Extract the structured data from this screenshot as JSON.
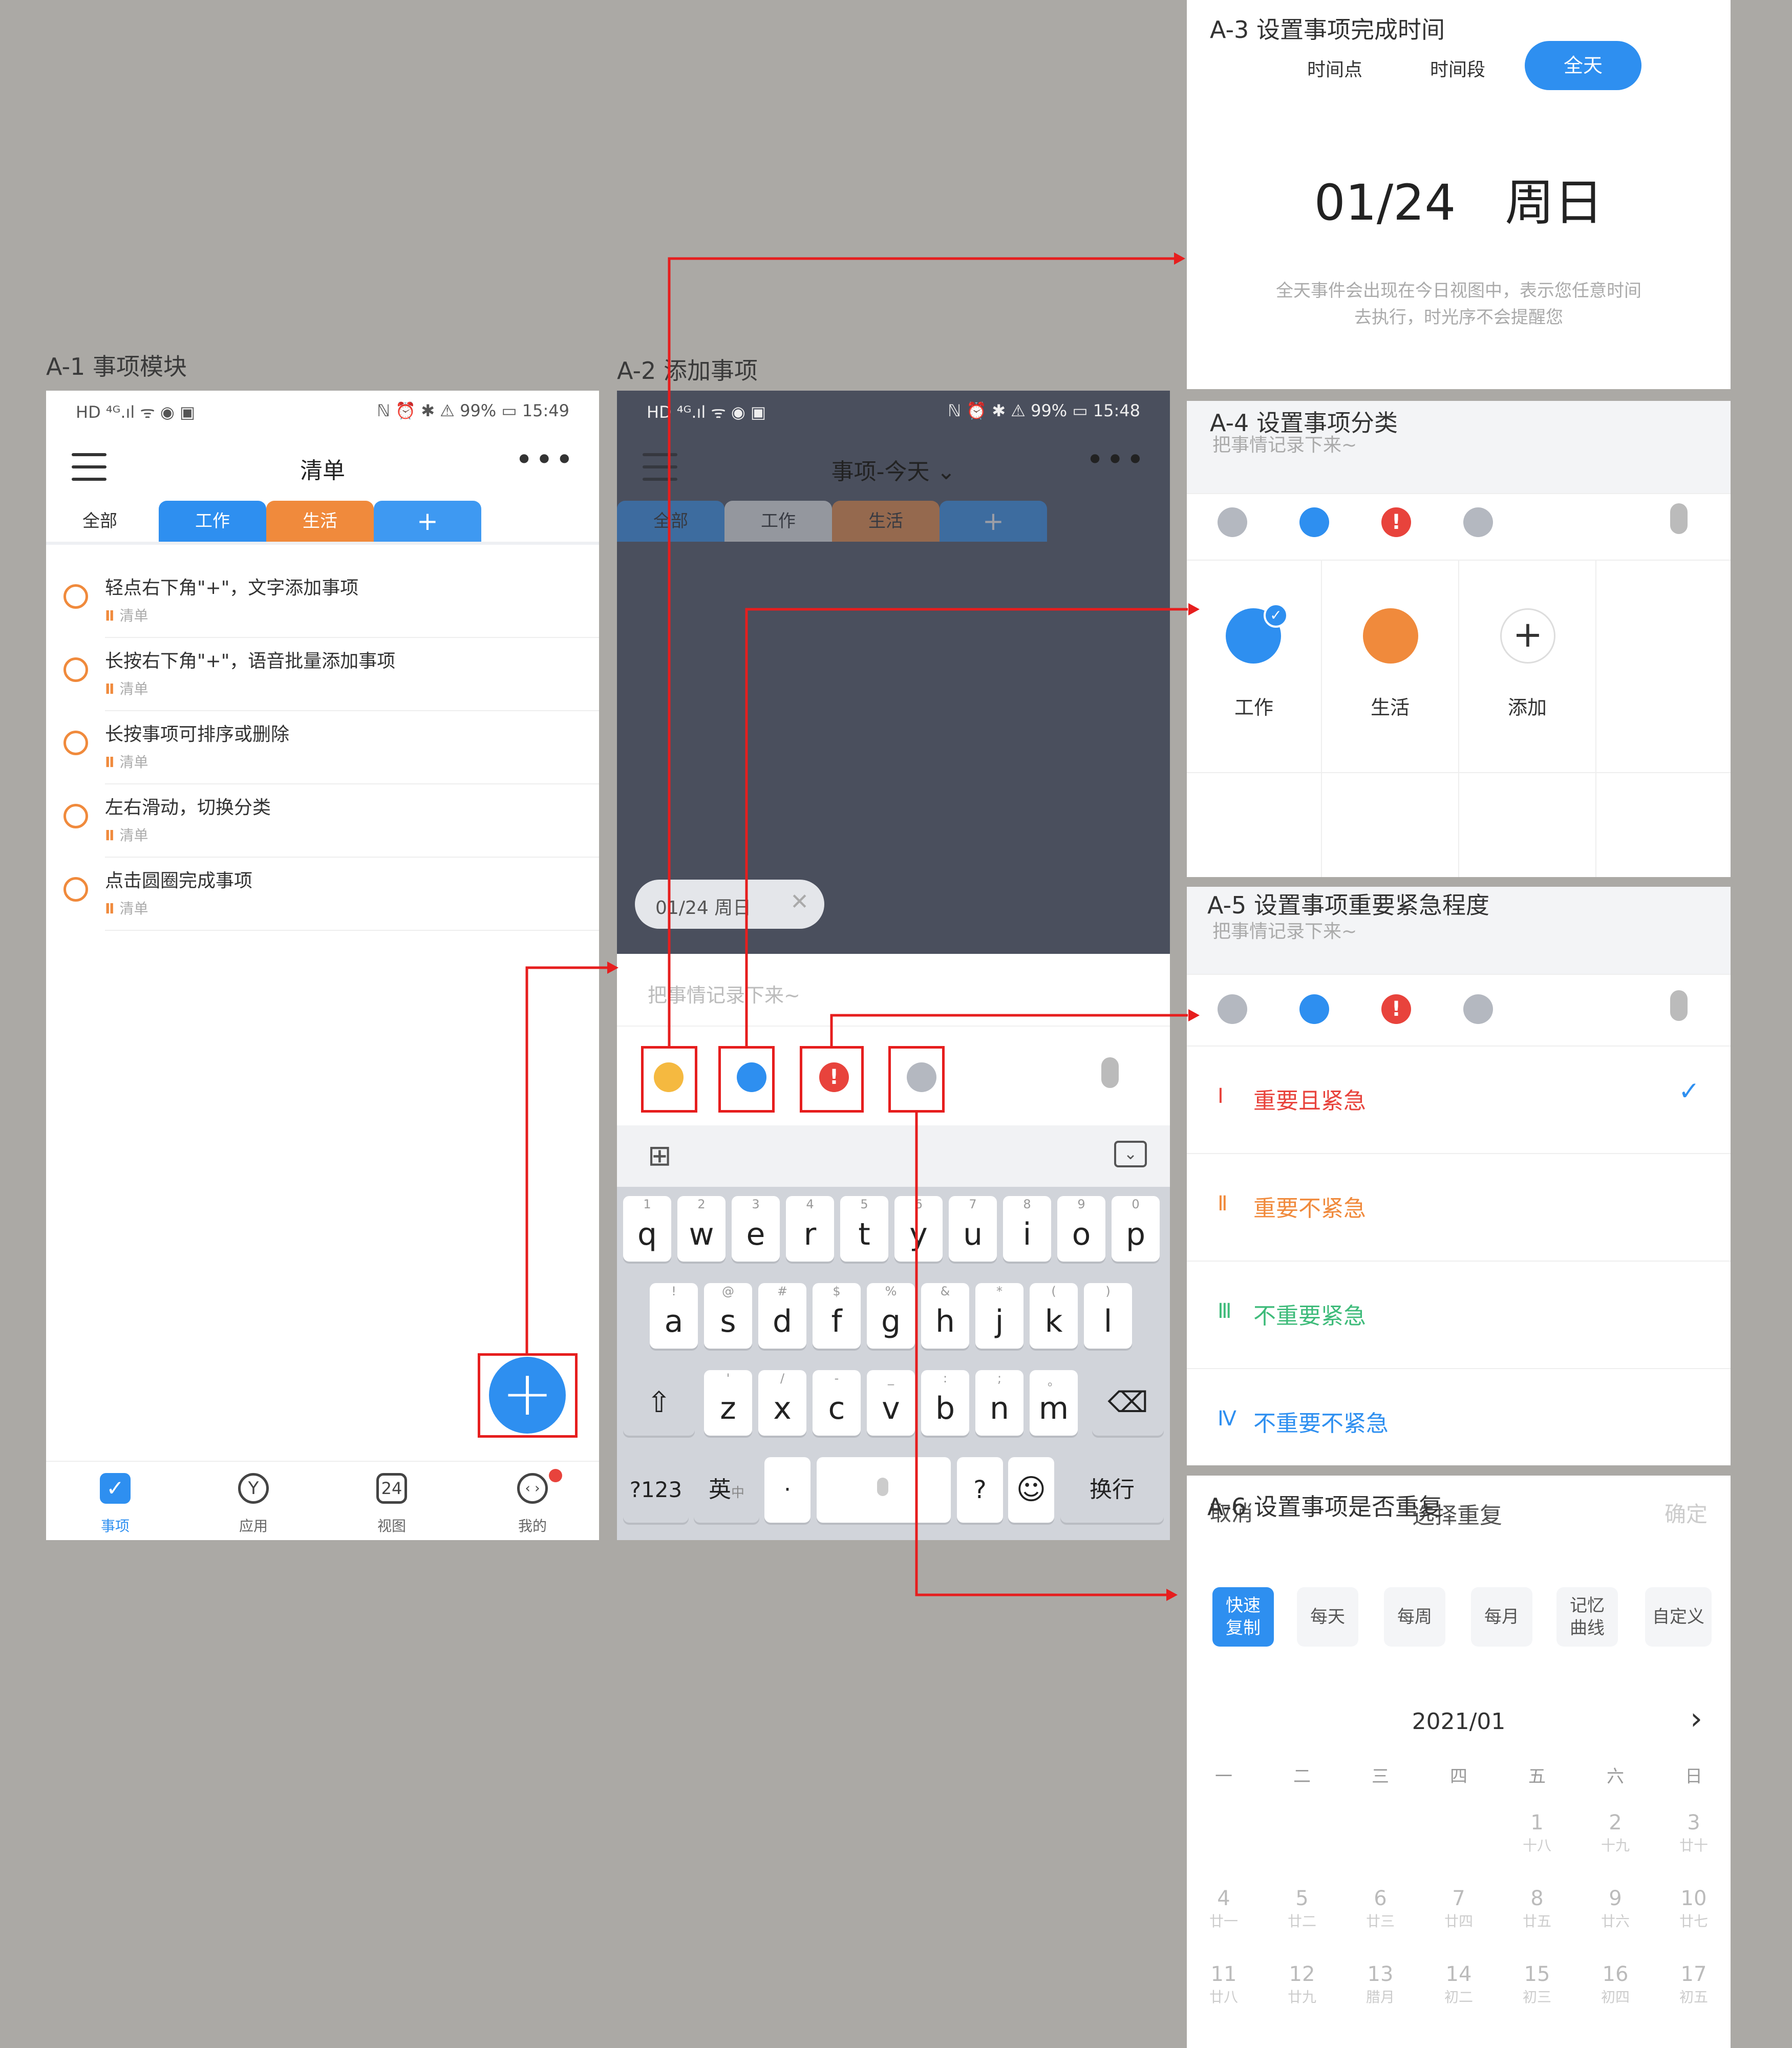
{
  "sections": {
    "a1": "A-1 事项模块",
    "a2": "A-2 添加事项",
    "a3": "A-3 设置事项完成时间",
    "a4": "A-4 设置事项分类",
    "a5": "A-5 设置事项重要紧急程度",
    "a6": "A-6 设置事项是否重复"
  },
  "a1": {
    "status_left": "HD ⁴ᴳ.ıl ᯤ ◉ ▣",
    "status_right": "ℕ ⏰ ✱ ⚠ 99% ▭ 15:49",
    "title": "清单",
    "tabs": [
      "全部",
      "工作",
      "生活",
      "+"
    ],
    "todos": [
      {
        "text": "轻点右下角\"+\"，文字添加事项",
        "tag": "清单"
      },
      {
        "text": "长按右下角\"+\"，语音批量添加事项",
        "tag": "清单"
      },
      {
        "text": "长按事项可排序或删除",
        "tag": "清单"
      },
      {
        "text": "左右滑动，切换分类",
        "tag": "清单"
      },
      {
        "text": "点击圆圈完成事项",
        "tag": "清单"
      }
    ],
    "tag_mark": "Ⅱ",
    "fab": "+",
    "nav": [
      "事项",
      "应用",
      "视图",
      "我的"
    ],
    "nav_view_icon": "24"
  },
  "a2": {
    "status_left": "HD ⁴ᴳ.ıl ᯤ ◉ ▣",
    "status_right": "ℕ ⏰ ✱ ⚠ 99% ▭ 15:48",
    "title": "事项-今天 ⌄",
    "tabs": [
      "全部",
      "工作",
      "生活",
      "+"
    ],
    "date_chip": "01/24 周日",
    "input_placeholder": "把事情记录下来~",
    "row1": [
      {
        "n": "1",
        "c": "q"
      },
      {
        "n": "2",
        "c": "w"
      },
      {
        "n": "3",
        "c": "e"
      },
      {
        "n": "4",
        "c": "r"
      },
      {
        "n": "5",
        "c": "t"
      },
      {
        "n": "6",
        "c": "y"
      },
      {
        "n": "7",
        "c": "u"
      },
      {
        "n": "8",
        "c": "i"
      },
      {
        "n": "9",
        "c": "o"
      },
      {
        "n": "0",
        "c": "p"
      }
    ],
    "row2": [
      {
        "n": "!",
        "c": "a"
      },
      {
        "n": "@",
        "c": "s"
      },
      {
        "n": "#",
        "c": "d"
      },
      {
        "n": "$",
        "c": "f"
      },
      {
        "n": "%",
        "c": "g"
      },
      {
        "n": "&",
        "c": "h"
      },
      {
        "n": "*",
        "c": "j"
      },
      {
        "n": "(",
        "c": "k"
      },
      {
        "n": ")",
        "c": "l"
      }
    ],
    "row3": [
      {
        "n": "'",
        "c": "z"
      },
      {
        "n": "/",
        "c": "x"
      },
      {
        "n": "-",
        "c": "c"
      },
      {
        "n": "_",
        "c": "v"
      },
      {
        "n": ":",
        "c": "b"
      },
      {
        "n": ";",
        "c": "n"
      },
      {
        "n": "。",
        "c": "m"
      }
    ],
    "key_123": "?123",
    "key_lang": "英",
    "key_lang_sub": "中",
    "key_dot": "·",
    "key_q": "?",
    "key_enter": "换行"
  },
  "a3": {
    "opts": [
      "时间点",
      "时间段",
      "全天"
    ],
    "date": "01/24　周日",
    "note1": "全天事件会出现在今日视图中，表示您任意时间",
    "note2": "去执行，时光序不会提醒您"
  },
  "a4": {
    "placeholder": "把事情记录下来~",
    "cats": [
      "工作",
      "生活",
      "添加"
    ]
  },
  "a5": {
    "placeholder": "把事情记录下来~",
    "items": [
      {
        "rn": "Ⅰ",
        "label": "重要且紧急",
        "color": "#E8433C"
      },
      {
        "rn": "Ⅱ",
        "label": "重要不紧急",
        "color": "#F08A3C"
      },
      {
        "rn": "Ⅲ",
        "label": "不重要紧急",
        "color": "#3EBB7A"
      },
      {
        "rn": "Ⅳ",
        "label": "不重要不紧急",
        "color": "#2E8FF0"
      }
    ],
    "check": "✓"
  },
  "a6": {
    "cancel": "取消",
    "header": "选择重复",
    "confirm": "确定",
    "chips": [
      "快速\n复制",
      "每天",
      "每周",
      "每月",
      "记忆\n曲线",
      "自定义"
    ],
    "month": "2021/01",
    "next": "›",
    "weekdays": [
      "一",
      "二",
      "三",
      "四",
      "五",
      "六",
      "日"
    ],
    "days": [
      {
        "d": "1",
        "l": "十八"
      },
      {
        "d": "2",
        "l": "十九"
      },
      {
        "d": "3",
        "l": "廿十"
      },
      {
        "d": "4",
        "l": "廿一"
      },
      {
        "d": "5",
        "l": "廿二"
      },
      {
        "d": "6",
        "l": "廿三"
      },
      {
        "d": "7",
        "l": "廿四"
      },
      {
        "d": "8",
        "l": "廿五"
      },
      {
        "d": "9",
        "l": "廿六"
      },
      {
        "d": "10",
        "l": "廿七"
      },
      {
        "d": "11",
        "l": "廿八"
      },
      {
        "d": "12",
        "l": "廿九"
      },
      {
        "d": "13",
        "l": "腊月"
      },
      {
        "d": "14",
        "l": "初二"
      },
      {
        "d": "15",
        "l": "初三"
      },
      {
        "d": "16",
        "l": "初四"
      },
      {
        "d": "17",
        "l": "初五"
      }
    ]
  },
  "colors": {
    "blue": "#2E8FF0",
    "orange": "#F08A3C",
    "red": "#E61E1E",
    "dark": "#4A4F5D"
  }
}
